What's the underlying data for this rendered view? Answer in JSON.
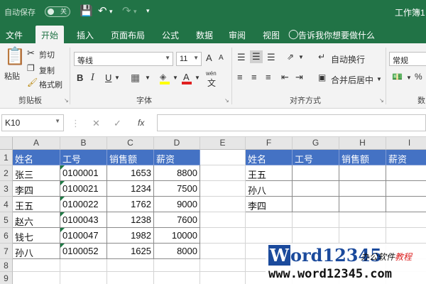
{
  "titlebar": {
    "autosave_label": "自动保存",
    "autosave_state": "关",
    "doc_title": "工作簿1"
  },
  "tabs": [
    {
      "label": "文件"
    },
    {
      "label": "开始"
    },
    {
      "label": "插入"
    },
    {
      "label": "页面布局"
    },
    {
      "label": "公式"
    },
    {
      "label": "数据"
    },
    {
      "label": "审阅"
    },
    {
      "label": "视图"
    }
  ],
  "tell_me": "告诉我你想要做什么",
  "ribbon": {
    "clipboard": {
      "paste": "粘贴",
      "cut": "剪切",
      "copy": "复制",
      "format_painter": "格式刷",
      "group": "剪贴板"
    },
    "font": {
      "name": "等线",
      "size": "11",
      "grow": "A",
      "shrink": "A",
      "bold": "B",
      "italic": "I",
      "underline": "U",
      "wen": "wén",
      "group": "字体"
    },
    "alignment": {
      "wrap": "自动换行",
      "merge": "合并后居中",
      "group": "对齐方式"
    },
    "number": {
      "format": "常规",
      "group": "数"
    }
  },
  "formula_bar": {
    "name_box": "K10",
    "fx": "fx",
    "value": ""
  },
  "columns": [
    "A",
    "B",
    "C",
    "D",
    "E",
    "F",
    "G",
    "H",
    "I"
  ],
  "rows": [
    "1",
    "2",
    "3",
    "4",
    "5",
    "6",
    "7",
    "8",
    "9"
  ],
  "table1": {
    "headers": [
      "姓名",
      "工号",
      "销售额",
      "薪资"
    ],
    "rows": [
      [
        "张三",
        "0100001",
        "1653",
        "8800"
      ],
      [
        "李四",
        "0100021",
        "1234",
        "7500"
      ],
      [
        "王五",
        "0100022",
        "1762",
        "9000"
      ],
      [
        "赵六",
        "0100043",
        "1238",
        "7600"
      ],
      [
        "钱七",
        "0100047",
        "1982",
        "10000"
      ],
      [
        "孙八",
        "0100052",
        "1625",
        "8000"
      ]
    ]
  },
  "table2": {
    "headers": [
      "姓名",
      "工号",
      "销售额",
      "薪资"
    ],
    "names": [
      "王五",
      "孙八",
      "李四"
    ]
  },
  "watermark": {
    "logo": "Word12345",
    "tag_a": "办公软件",
    "tag_b": "教程",
    "url": "www.word12345.com"
  },
  "colors": {
    "excel_green": "#217346",
    "header_blue": "#4472c4",
    "logo_blue": "#1b4a9c"
  }
}
